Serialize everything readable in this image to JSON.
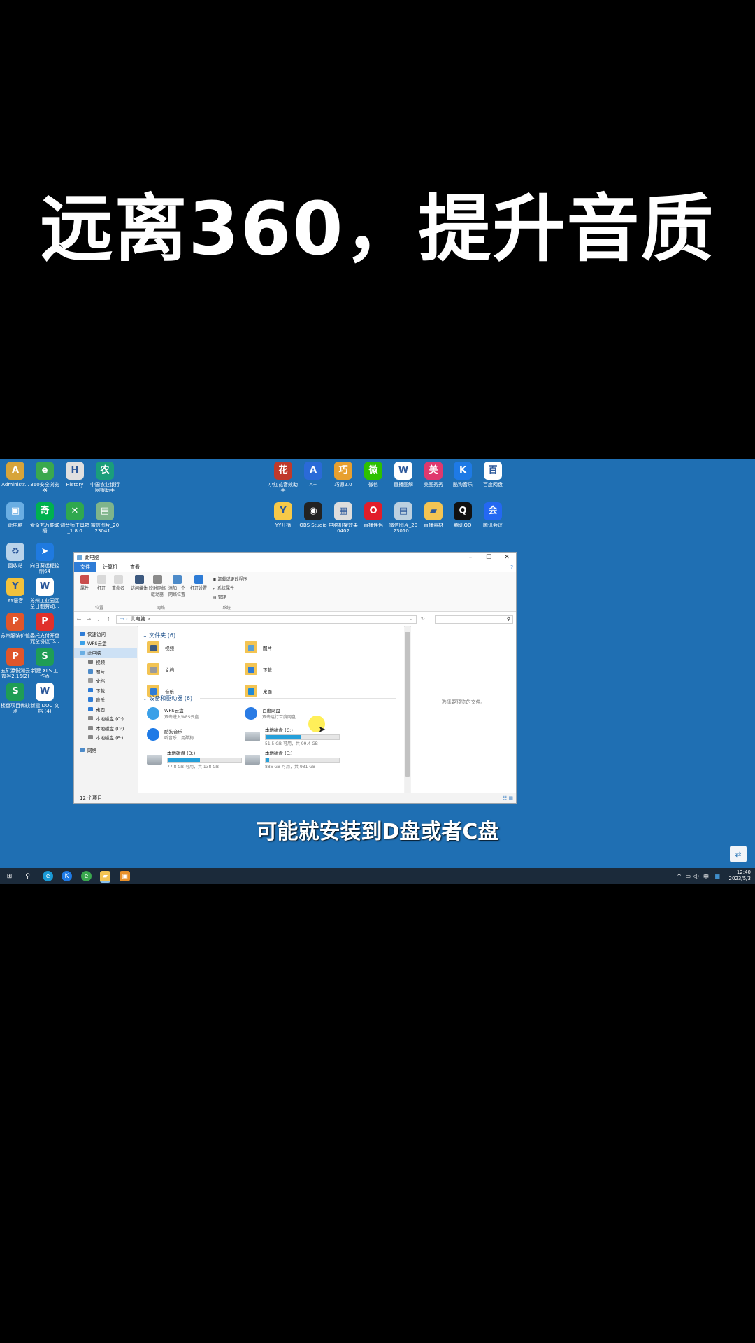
{
  "headline": "远离360，提升音质",
  "subtitle": "可能就安装到D盘或者C盘",
  "desktop_icons": [
    {
      "label": "Administr...",
      "color": "#d7a43a",
      "glyph": "A"
    },
    {
      "label": "360安全浏览器",
      "color": "#3aa84e",
      "glyph": "e"
    },
    {
      "label": "History",
      "color": "#e0e0e0",
      "glyph": "H"
    },
    {
      "label": "中国农业银行网银助手",
      "color": "#1a9e7b",
      "glyph": "农"
    },
    {
      "label": "小红花音效助手",
      "color": "#c0392b",
      "glyph": "花"
    },
    {
      "label": "A+",
      "color": "#2a6ad8",
      "glyph": "A"
    },
    {
      "label": "巧源2.0",
      "color": "#e8a030",
      "glyph": "巧"
    },
    {
      "label": "微信",
      "color": "#2dc100",
      "glyph": "微"
    },
    {
      "label": "直播图解",
      "color": "#ffffff",
      "glyph": "W"
    },
    {
      "label": "美图秀秀",
      "color": "#e0396e",
      "glyph": "美"
    },
    {
      "label": "酷狗音乐",
      "color": "#1e7ae6",
      "glyph": "K"
    },
    {
      "label": "百度网盘",
      "color": "#ffffff",
      "glyph": "百"
    },
    {
      "label": "此电脑",
      "color": "#6aaee3",
      "glyph": "▣"
    },
    {
      "label": "爱奇艺万能联播",
      "color": "#00b14f",
      "glyph": "奇"
    },
    {
      "label": "调音师工具箱_1.8.0",
      "color": "#2fa84f",
      "glyph": "✕"
    },
    {
      "label": "微信图片_2023041...",
      "color": "#7fb48b",
      "glyph": "▤"
    },
    {
      "label": "YY开播",
      "color": "#f7c948",
      "glyph": "Y"
    },
    {
      "label": "OBS Studio",
      "color": "#222222",
      "glyph": "◉"
    },
    {
      "label": "电脑机架效果0402",
      "color": "#dddddd",
      "glyph": "▦"
    },
    {
      "label": "直播伴侣",
      "color": "#e11d2b",
      "glyph": "O"
    },
    {
      "label": "微信图片_2023010...",
      "color": "#bcd0e0",
      "glyph": "▤"
    },
    {
      "label": "直播素材",
      "color": "#f3c453",
      "glyph": "▰"
    },
    {
      "label": "腾讯QQ",
      "color": "#111111",
      "glyph": "Q"
    },
    {
      "label": "腾讯会议",
      "color": "#2468f2",
      "glyph": "会"
    },
    {
      "label": "回收站",
      "color": "#b9d3ea",
      "glyph": "♻"
    },
    {
      "label": "向日葵远程控制64",
      "color": "#1f7ae0",
      "glyph": "➤"
    },
    {
      "label": "YY语音",
      "color": "#f3c23c",
      "glyph": "Y"
    },
    {
      "label": "苏州工业园区全日制劳动...",
      "color": "#ffffff",
      "glyph": "W"
    },
    {
      "label": "苏州服装价值",
      "color": "#e0562b",
      "glyph": "P"
    },
    {
      "label": "委托支付开盘完全协议书...",
      "color": "#e0302b",
      "glyph": "P"
    },
    {
      "label": "五矿瀛悦湖云霞谷2.16(2)",
      "color": "#e0562b",
      "glyph": "P"
    },
    {
      "label": "新建 XLS 工作表",
      "color": "#1f9d55",
      "glyph": "S"
    },
    {
      "label": "楼盘项目优缺点",
      "color": "#1f9d55",
      "glyph": "S"
    },
    {
      "label": "新建 DOC 文档 (4)",
      "color": "#ffffff",
      "glyph": "W"
    }
  ],
  "explorer": {
    "title": "此电脑",
    "tabs": [
      "文件",
      "计算机",
      "查看"
    ],
    "ribbon": {
      "buttons": [
        "属性",
        "打开",
        "重命名",
        "访问媒体",
        "映射网络驱动器",
        "添加一个网络位置",
        "打开设置"
      ],
      "system_items": [
        "卸载或更改程序",
        "系统属性",
        "管理"
      ],
      "groups": [
        "位置",
        "网络",
        "系统"
      ]
    },
    "address": "此电脑",
    "nav": [
      "快速访问",
      "WPS云盘",
      "此电脑",
      "视频",
      "图片",
      "文档",
      "下载",
      "音乐",
      "桌面",
      "本地磁盘 (C:)",
      "本地磁盘 (D:)",
      "本地磁盘 (E:)",
      "网络"
    ],
    "folders_header": "文件夹 (6)",
    "folders": [
      "视频",
      "图片",
      "文档",
      "下载",
      "音乐",
      "桌面"
    ],
    "devices_header": "设备和驱动器 (6)",
    "devices": [
      {
        "name": "WPS云盘",
        "sub": "双击进入WPS云盘",
        "color": "#3aa0e8"
      },
      {
        "name": "百度网盘",
        "sub": "双击运行百度网盘",
        "color": "#2a7be4"
      },
      {
        "name": "酷狗音乐",
        "sub": "听音乐，用酷狗",
        "color": "#1e7ae6"
      }
    ],
    "drives": [
      {
        "name": "本地磁盘 (C:)",
        "free": "51.5 GB 可用，共 99.4 GB",
        "used_fraction": 0.48
      },
      {
        "name": "本地磁盘 (D:)",
        "free": "77.8 GB 可用，共 138 GB",
        "used_fraction": 0.44
      },
      {
        "name": "本地磁盘 (E:)",
        "free": "886 GB 可用，共 931 GB",
        "used_fraction": 0.05
      }
    ],
    "preview_text": "选择要预览的文件。",
    "status": "12 个项目"
  },
  "taskbar": {
    "time": "12:40",
    "date": "2023/5/3",
    "ime": "中"
  }
}
